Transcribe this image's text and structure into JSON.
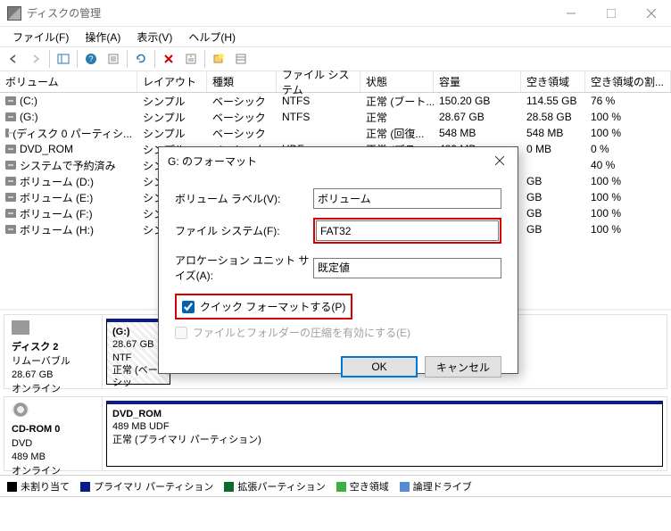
{
  "title": "ディスクの管理",
  "menu": {
    "file": "ファイル(F)",
    "action": "操作(A)",
    "view": "表示(V)",
    "help": "ヘルプ(H)"
  },
  "columns": {
    "volume": "ボリューム",
    "layout": "レイアウト",
    "type": "種類",
    "fs": "ファイル システム",
    "status": "状態",
    "capacity": "容量",
    "free": "空き領域",
    "freepct": "空き領域の割..."
  },
  "rows": [
    {
      "vol": "(C:)",
      "layout": "シンプル",
      "type": "ベーシック",
      "fs": "NTFS",
      "status": "正常 (ブート...",
      "cap": "150.20 GB",
      "free": "114.55 GB",
      "pct": "76 %"
    },
    {
      "vol": "(G:)",
      "layout": "シンプル",
      "type": "ベーシック",
      "fs": "NTFS",
      "status": "正常",
      "cap": "28.67 GB",
      "free": "28.58 GB",
      "pct": "100 %"
    },
    {
      "vol": "(ディスク 0 パーティシ...",
      "layout": "シンプル",
      "type": "ベーシック",
      "fs": "",
      "status": "正常 (回復...",
      "cap": "548 MB",
      "free": "548 MB",
      "pct": "100 %"
    },
    {
      "vol": "DVD_ROM",
      "layout": "シンプル",
      "type": "ベーシック",
      "fs": "UDF",
      "status": "正常 (プラ...",
      "cap": "489 MB",
      "free": "0 MB",
      "pct": "0 %"
    },
    {
      "vol": "システムで予約済み",
      "layout": "シンプル",
      "type": "",
      "fs": "",
      "status": "",
      "cap": "",
      "free": "",
      "pct": "40 %"
    },
    {
      "vol": "ボリューム (D:)",
      "layout": "シンプル",
      "type": "",
      "fs": "",
      "status": "",
      "cap": "",
      "free": "GB",
      "pct": "100 %"
    },
    {
      "vol": "ボリューム (E:)",
      "layout": "シンプル",
      "type": "",
      "fs": "",
      "status": "",
      "cap": "",
      "free": "GB",
      "pct": "100 %"
    },
    {
      "vol": "ボリューム (F:)",
      "layout": "シンプル",
      "type": "",
      "fs": "",
      "status": "",
      "cap": "",
      "free": "GB",
      "pct": "100 %"
    },
    {
      "vol": "ボリューム (H:)",
      "layout": "シンプル",
      "type": "",
      "fs": "",
      "status": "",
      "cap": "",
      "free": "GB",
      "pct": "100 %"
    }
  ],
  "disk2": {
    "header": "ディスク 2",
    "type": "リムーバブル",
    "size": "28.67 GB",
    "status": "オンライン",
    "part_name": "(G:)",
    "part_info": "28.67 GB NTF",
    "part_st": "正常 (ベーシッ"
  },
  "cd": {
    "header": "CD-ROM 0",
    "type": "DVD",
    "size": "489 MB",
    "status": "オンライン",
    "part_name": "DVD_ROM",
    "part_info": "489 MB UDF",
    "part_st": "正常 (プライマリ パーティション)"
  },
  "legend": {
    "unalloc": "未割り当て",
    "primary": "プライマリ パーティション",
    "ext": "拡張パーティション",
    "free": "空き領域",
    "logical": "論理ドライブ"
  },
  "dialog": {
    "title": "G: のフォーマット",
    "vol_label_lbl": "ボリューム ラベル(V):",
    "vol_label_val": "ボリューム",
    "fs_lbl": "ファイル システム(F):",
    "fs_val": "FAT32",
    "alloc_lbl": "アロケーション ユニット サイズ(A):",
    "alloc_val": "既定値",
    "quick": "クイック フォーマットする(P)",
    "compress": "ファイルとフォルダーの圧縮を有効にする(E)",
    "ok": "OK",
    "cancel": "キャンセル"
  }
}
